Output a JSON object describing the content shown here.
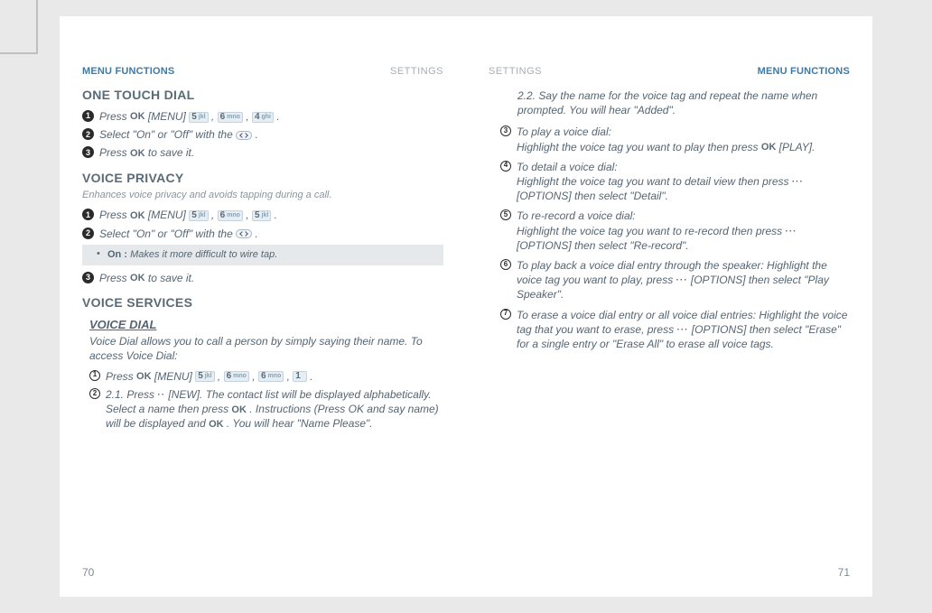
{
  "header": {
    "left_main": "MENU FUNCTIONS",
    "left_sub": "SETTINGS",
    "right_sub": "SETTINGS",
    "right_main": "MENU FUNCTIONS"
  },
  "pagenum": {
    "left": "70",
    "right": "71"
  },
  "keys": {
    "ok": "OK",
    "k5": {
      "num": "5",
      "abc": "jkl"
    },
    "k6": {
      "num": "6",
      "abc": "mno"
    },
    "k4": {
      "num": "4",
      "abc": "ghi"
    },
    "k1": {
      "num": "1",
      "abc": ""
    }
  },
  "left": {
    "one_touch": {
      "title": "ONE TOUCH DIAL",
      "s1a": "Press ",
      "s1b": " [MENU]  ",
      "s1c": "  ,  ",
      "s1d": ",  ",
      "s1e": "  .",
      "s2a": "Select \"On\" or \"Off\" with the ",
      "s2b": "  .",
      "s3a": "Press ",
      "s3b": "  to save it."
    },
    "voice_privacy": {
      "title": "VOICE PRIVACY",
      "sub": "Enhances voice privacy and avoids tapping during a call.",
      "s1a": "Press ",
      "s1b": " [MENU]  ",
      "s1c": "  ,  ",
      "s1d": ",  ",
      "s1e": "  .",
      "s2a": "Select \"On\" or \"Off\" with the ",
      "s2b": "  .",
      "note_b": "On : ",
      "note_t": "Makes it more difficult to wire tap.",
      "s3a": "Press ",
      "s3b": "  to save it."
    },
    "voice_services": {
      "title": "VOICE SERVICES",
      "vd_title": "VOICE DIAL",
      "vd_desc": "Voice Dial allows you to call a person by simply saying their name. To access Voice Dial:",
      "s1a": "Press ",
      "s1b": " [MENU]  ",
      "s1c": "  ,  ",
      "s1d": " ,  ",
      "s1e": " ,   ",
      "s1f": "  .",
      "s2": "2.1. Press ",
      "s2b": "  [NEW]. The contact list will be displayed alphabetically. Select a name then press ",
      "s2c": "  . Instructions (Press OK and say name) will be displayed and ",
      "s2d": "  . You will hear \"Name Please\"."
    }
  },
  "right": {
    "r22": "2.2. Say the name for the voice tag and repeat the name when prompted. You will hear \"Added\".",
    "r3a": "To play a voice dial:",
    "r3b": "Highlight the voice tag you want to play then press ",
    "r3c": " [PLAY].",
    "r4a": "To detail a voice dial:",
    "r4b": "Highlight the voice tag you want to detail view then press ",
    "r4c": " [OPTIONS] then select \"Detail\".",
    "r5a": "To re-record a voice dial:",
    "r5b": "Highlight the voice tag you want to re-record then press ",
    "r5c": " [OPTIONS] then select \"Re-record\".",
    "r6a": "To play back a voice dial entry through the speaker: Highlight the voice tag you want to play, press ",
    "r6b": " [OPTIONS] then select \"Play Speaker\".",
    "r7a": "To erase a voice dial entry or all voice dial entries: Highlight the voice tag that you want to erase, press ",
    "r7b": " [OPTIONS] then select \"Erase\" for a single entry or \"Erase All\" to erase all voice tags."
  }
}
